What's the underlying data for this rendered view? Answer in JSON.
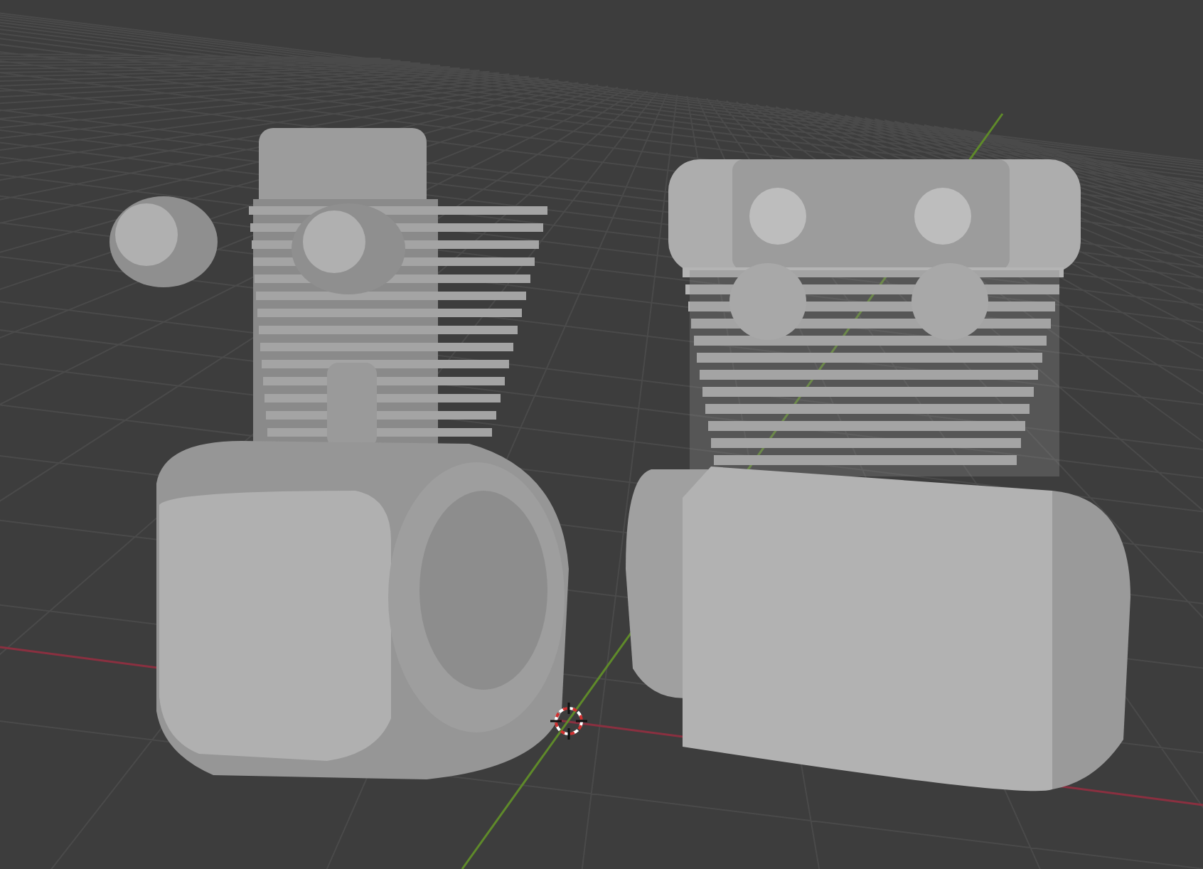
{
  "viewport": {
    "models": [
      {
        "kind": "finned-engine"
      },
      {
        "kind": "block-engine"
      }
    ]
  }
}
